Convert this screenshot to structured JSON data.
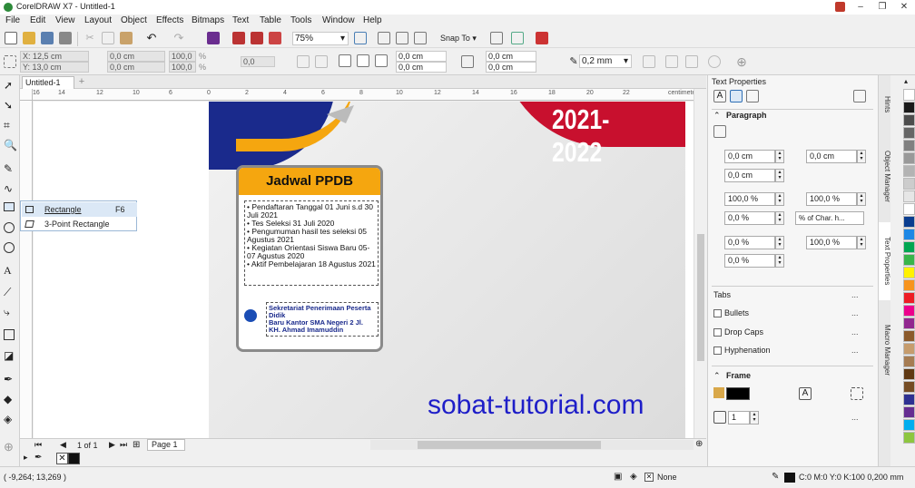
{
  "window": {
    "title": "CorelDRAW X7 - Untitled-1"
  },
  "menu": [
    "File",
    "Edit",
    "View",
    "Layout",
    "Object",
    "Effects",
    "Bitmaps",
    "Text",
    "Table",
    "Tools",
    "Window",
    "Help"
  ],
  "toolbar": {
    "zoom": "75%",
    "snap_to": "Snap To"
  },
  "propbar": {
    "x": "X: 12,5 cm",
    "y": "Y: 13,0 cm",
    "w": "0,0 cm",
    "h": "0,0 cm",
    "scale_w": "100,0",
    "scale_h": "100,0",
    "pct": "%",
    "angle": "0,0",
    "c1": "0,0 cm",
    "c2": "0,0 cm",
    "c3": "0,0 cm",
    "c4": "0,0 cm",
    "outline": "0,2 mm"
  },
  "document": {
    "tab": "Untitled-1",
    "ruler_unit": "centimeters",
    "ruler_ticks": [
      "16",
      "14",
      "12",
      "10",
      "8",
      "6",
      "4",
      "2",
      "0",
      "2",
      "4",
      "6",
      "8",
      "10",
      "12",
      "14",
      "16",
      "18",
      "20",
      "22",
      "24",
      "26"
    ],
    "page_label": "Page 1",
    "page_count": "1 of 1"
  },
  "flyout": {
    "items": [
      {
        "label": "Rectangle",
        "shortcut": "F6"
      },
      {
        "label": "3-Point Rectangle",
        "shortcut": ""
      }
    ]
  },
  "design": {
    "year": "2021-2022",
    "card_title": "Jadwal PPDB",
    "schedule": [
      "Pendaftaran Tanggal 01 Juni s.d 30 Juli 2021",
      "Tes Seleksi 31 Juli 2020",
      "Pengumuman hasil tes seleksi 05 Agustus 2021",
      "Kegiatan Orientasi Siswa Baru 05-07 Agustus 2020",
      "Aktif Pembelajaran 18 Agustus 2021"
    ],
    "address": [
      "Sekretariat Penerimaan Peserta Didik",
      "Baru Kantor SMA Negeri 2 Jl.",
      "KH. Ahmad Imamuddin"
    ],
    "watermark": "sobat-tutorial.com",
    "colors": {
      "blue": "#1a2a8c",
      "orange": "#f5a60f",
      "red": "#c8102e",
      "watermark": "#1e1ec8"
    }
  },
  "panel": {
    "title": "Text Properties",
    "paragraph": "Paragraph",
    "indent_first": "0,0 cm",
    "indent_right": "0,0 cm",
    "indent_left": "0,0 cm",
    "spacing1": "100,0 %",
    "spacing2": "100,0 %",
    "spacing3": "0,0 %",
    "spacing_unit": "% of Char. h...",
    "char1": "0,0 %",
    "char2": "100,0 %",
    "char3": "0,0 %",
    "tabs": "Tabs",
    "bullets": "Bullets",
    "drop_caps": "Drop Caps",
    "hyphenation": "Hyphenation",
    "frame": "Frame",
    "columns": "1"
  },
  "sidetabs": [
    "Hints",
    "Object Manager",
    "Text Properties",
    "Macro Manager"
  ],
  "palette": [
    "#ffffff",
    "#1a1a1a",
    "#4d4d4d",
    "#666666",
    "#808080",
    "#999999",
    "#b3b3b3",
    "#cccccc",
    "#e6e6e6",
    "#ffffff",
    "#0a3d8f",
    "#1e88e5",
    "#00a651",
    "#39b54a",
    "#fff200",
    "#f7941d",
    "#ed1c24",
    "#ec008c",
    "#92278f",
    "#8b5a2b",
    "#c69c6d",
    "#a67c52",
    "#603913",
    "#754c24",
    "#2e3192",
    "#662d91",
    "#00aeef",
    "#8dc63f"
  ],
  "status": {
    "coords": "( -9,264; 13,269 )",
    "fill": "None",
    "outline": "C:0 M:0 Y:0 K:100  0,200 mm"
  }
}
